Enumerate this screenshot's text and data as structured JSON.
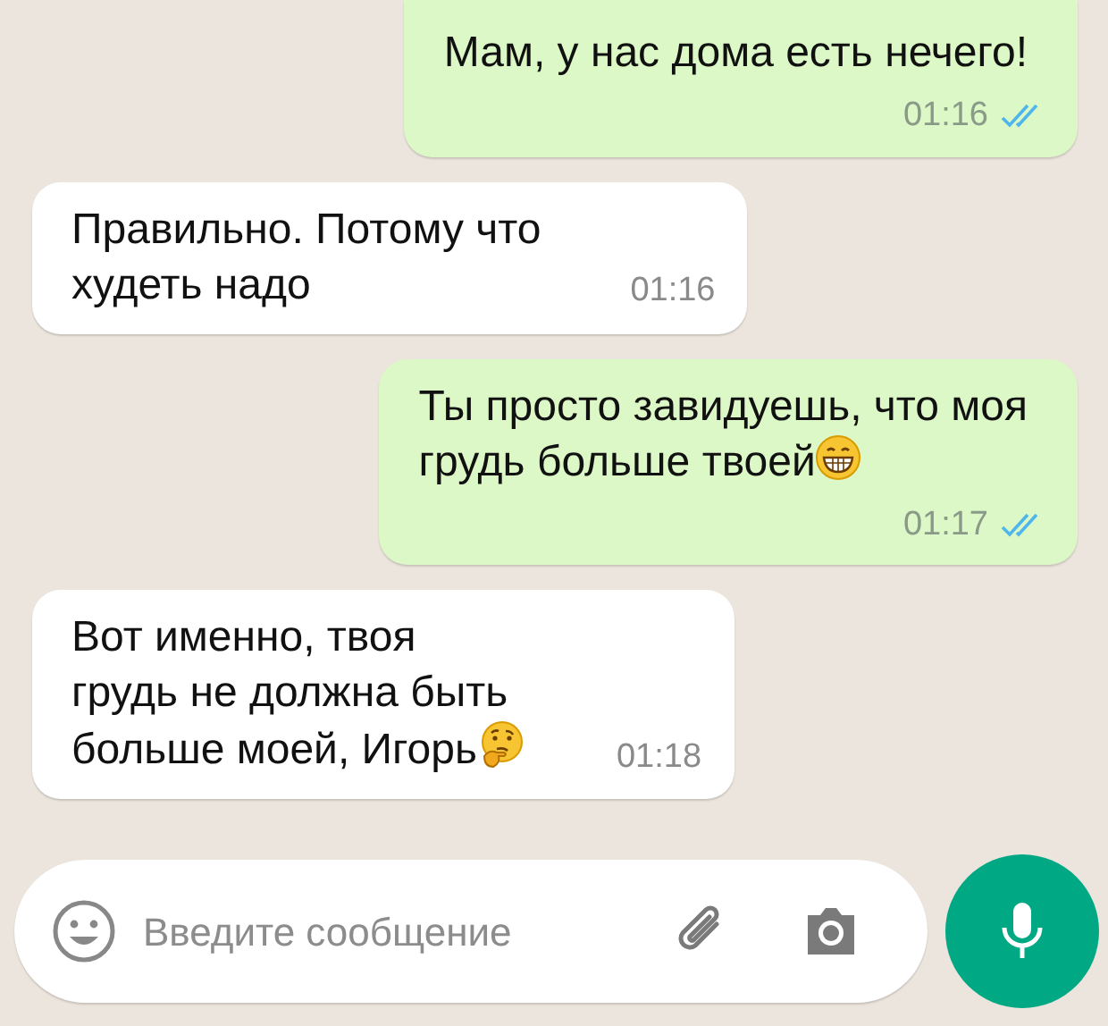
{
  "messages": [
    {
      "kind": "outgoing",
      "content": [
        {
          "kind": "text",
          "text": "Мам, у нас дома есть нечего!"
        }
      ],
      "time": "01:16",
      "read": true
    },
    {
      "kind": "incoming",
      "content": [
        {
          "kind": "text",
          "text": "Правильно. Потому что\nхудеть надо"
        }
      ],
      "time": "01:16"
    },
    {
      "kind": "outgoing",
      "content": [
        {
          "kind": "text",
          "text": "Ты просто завидуешь, что моя\nгрудь больше твоей"
        },
        {
          "kind": "grin"
        }
      ],
      "time": "01:17",
      "read": true
    },
    {
      "kind": "incoming",
      "content": [
        {
          "kind": "text",
          "text": "Вот именно, твоя\nгрудь не должна быть\nбольше моей, Игорь"
        },
        {
          "kind": "think"
        }
      ],
      "time": "01:18"
    }
  ],
  "composer": {
    "placeholder": "Введите сообщение"
  }
}
